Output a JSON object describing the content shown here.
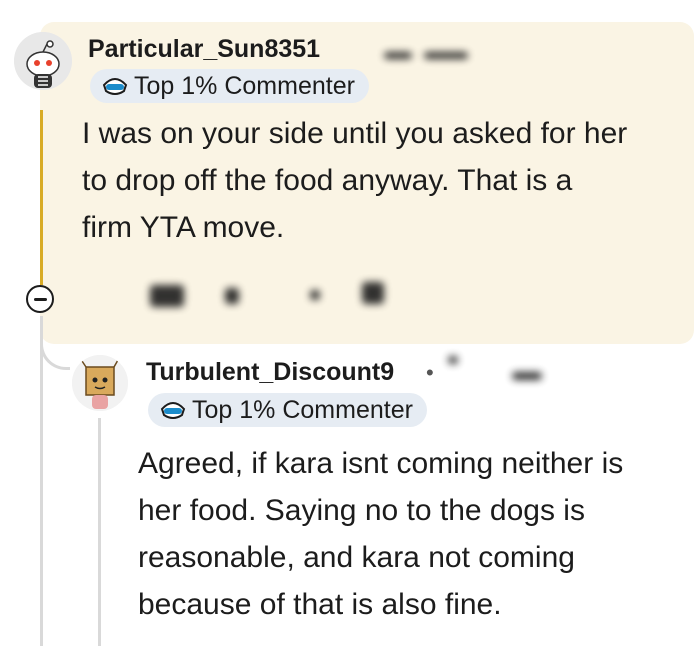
{
  "comments": [
    {
      "username": "Particular_Sun8351",
      "badge": "Top 1% Commenter",
      "body_lines": [
        "I was on your side until you asked for her",
        "to drop off the food anyway. That is a",
        "firm YTA move."
      ]
    },
    {
      "username": "Turbulent_Discount9",
      "separator": "•",
      "badge": "Top 1% Commenter",
      "body_lines": [
        "Agreed, if kara isnt coming neither is",
        "her food. Saying no to the dogs is",
        "reasonable, and kara not coming",
        "because of that is also fine."
      ]
    }
  ],
  "icons": {
    "avatar_1": "snoo-avatar-icon",
    "avatar_2": "box-head-avatar-icon",
    "badge": "visor-icon",
    "collapse": "collapse-thread-icon"
  },
  "colors": {
    "highlight_bg": "#faf4e4",
    "thread_highlight": "#d8ab25",
    "badge_bg": "#e6ecf3",
    "text": "#1c1c1c"
  }
}
